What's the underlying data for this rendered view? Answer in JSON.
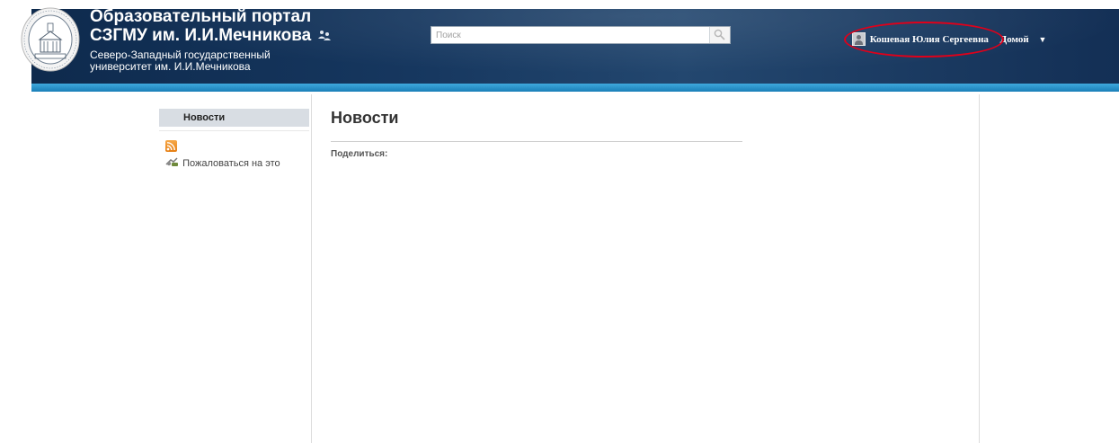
{
  "header": {
    "title_line1": "Образовательный портал",
    "title_line2": "СЗГМУ им. И.И.Мечникова",
    "subtitle_line1": "Северо-Западный государственный",
    "subtitle_line2": "университет им. И.И.Мечникова",
    "seal_icon": "university-seal-icon"
  },
  "search": {
    "placeholder": "Поиск",
    "icon": "search-icon"
  },
  "user": {
    "name": "Кошевая Юлия Сергеевна",
    "home_label": "Домой",
    "menu_arrow": "▼",
    "highlight_color": "#e0001a"
  },
  "sidebar": {
    "items": [
      {
        "label": "Новости"
      }
    ],
    "rss_icon": "rss-icon",
    "report_label": "Пожаловаться на это"
  },
  "main": {
    "title": "Новости",
    "share_label": "Поделиться:"
  },
  "colors": {
    "header_bg": "#16375f",
    "accent_stripe": "#3fa9dd",
    "nav_bg": "#d8dde3"
  }
}
